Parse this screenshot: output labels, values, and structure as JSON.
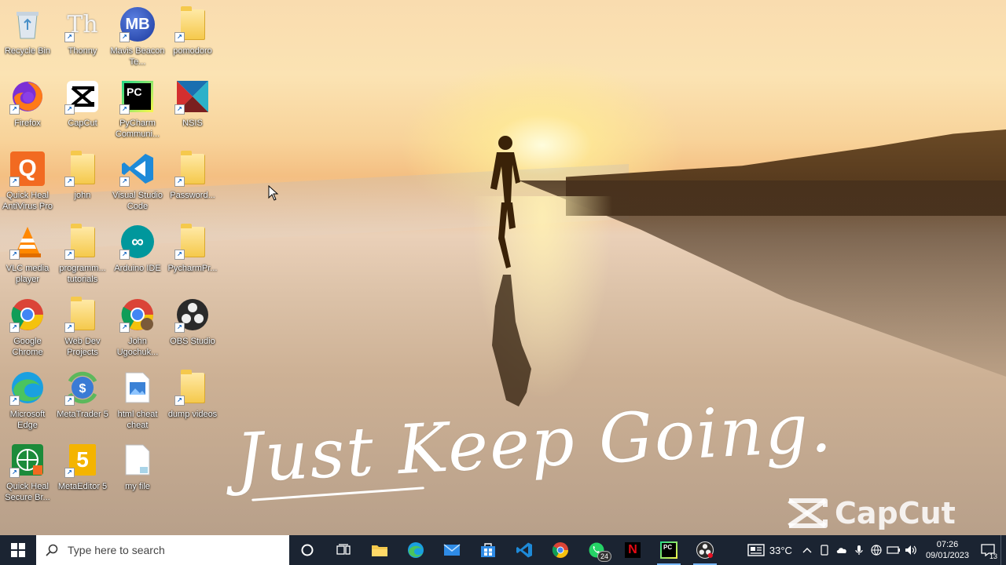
{
  "desktop": {
    "motto": "Just Keep Going.",
    "watermark": "CapCut",
    "icons": [
      {
        "label": "Recycle Bin",
        "icon": "recycle-bin-icon"
      },
      {
        "label": "Thonny",
        "icon": "thonny-icon"
      },
      {
        "label": "Mavis Beacon Te...",
        "icon": "mavis-beacon-icon",
        "badge": "MB"
      },
      {
        "label": "pomodoro",
        "icon": "pomodoro-icon"
      },
      {
        "label": "Firefox",
        "icon": "firefox-icon"
      },
      {
        "label": "CapCut",
        "icon": "capcut-icon"
      },
      {
        "label": "PyCharm Communi...",
        "icon": "pycharm-icon",
        "badge": "PC"
      },
      {
        "label": "NSIS",
        "icon": "nsis-icon"
      },
      {
        "label": "Quick Heal AntiVirus Pro",
        "icon": "quick-heal-icon",
        "badge": "Q"
      },
      {
        "label": "john",
        "icon": "folder-icon"
      },
      {
        "label": "Visual Studio Code",
        "icon": "vscode-icon"
      },
      {
        "label": "Password...",
        "icon": "password-file-icon"
      },
      {
        "label": "VLC media player",
        "icon": "vlc-icon"
      },
      {
        "label": "programm... tutorials",
        "icon": "folder-icon"
      },
      {
        "label": "Arduino IDE",
        "icon": "arduino-icon"
      },
      {
        "label": "PycharmPr...",
        "icon": "pycharm-project-icon"
      },
      {
        "label": "Google Chrome",
        "icon": "chrome-icon"
      },
      {
        "label": "Web Dev Projects",
        "icon": "folder-icon"
      },
      {
        "label": "John Ugochuk...",
        "icon": "chrome-profile-icon"
      },
      {
        "label": "OBS Studio",
        "icon": "obs-icon"
      },
      {
        "label": "Microsoft Edge",
        "icon": "edge-icon"
      },
      {
        "label": "MetaTrader 5",
        "icon": "metatrader-icon"
      },
      {
        "label": "html cheat cheat",
        "icon": "image-file-icon"
      },
      {
        "label": "dump videos",
        "icon": "folder-icon"
      },
      {
        "label": "Quick Heal Secure Br...",
        "icon": "quick-heal-browser-icon"
      },
      {
        "label": "MetaEditor 5",
        "icon": "metaeditor-icon",
        "badge": "5"
      },
      {
        "label": "my file",
        "icon": "text-file-icon"
      }
    ]
  },
  "taskbar": {
    "search_placeholder": "Type here to search",
    "apps": [
      {
        "name": "cortana",
        "icon": "cortana-icon"
      },
      {
        "name": "task-view",
        "icon": "task-view-icon"
      },
      {
        "name": "file-explorer",
        "icon": "file-explorer-icon"
      },
      {
        "name": "edge",
        "icon": "edge-icon"
      },
      {
        "name": "mail",
        "icon": "mail-icon"
      },
      {
        "name": "store",
        "icon": "store-icon"
      },
      {
        "name": "vscode",
        "icon": "vscode-icon"
      },
      {
        "name": "chrome",
        "icon": "chrome-icon"
      },
      {
        "name": "whatsapp",
        "icon": "whatsapp-icon",
        "badge": "24"
      },
      {
        "name": "netflix",
        "icon": "netflix-icon"
      },
      {
        "name": "pycharm",
        "icon": "pycharm-icon",
        "badge_text": "PC"
      },
      {
        "name": "obs",
        "icon": "obs-icon"
      }
    ],
    "weather": "33°C",
    "time": "07:26",
    "date": "09/01/2023",
    "notifications": "13"
  }
}
